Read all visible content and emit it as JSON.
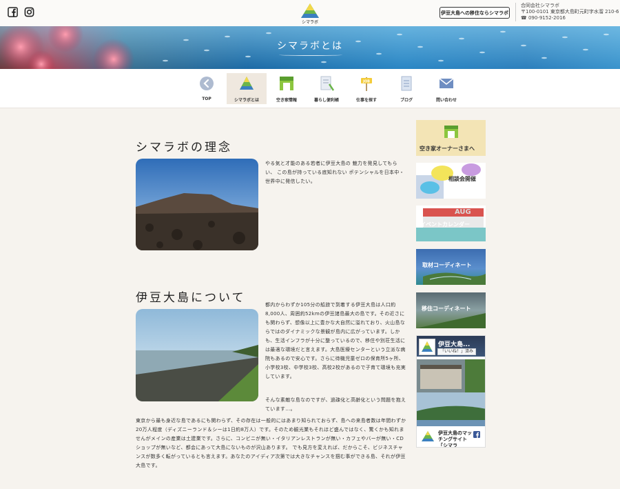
{
  "header": {
    "social": [
      "facebook-icon",
      "instagram-icon"
    ],
    "logo_text": "シマラボ",
    "cta_label": "伊豆大島への移住ならシマラボ",
    "company_name": "合同会社シマラボ",
    "company_address": "〒100-0101 東京都大島町元町字水溜 210-6",
    "company_phone": "☎ 090-9152-2016"
  },
  "hero": {
    "title": "シマラボとは"
  },
  "nav": {
    "items": [
      {
        "label": "TOP",
        "icon": "back-arrow-icon"
      },
      {
        "label": "シマラボとは",
        "icon": "mountain-logo-icon"
      },
      {
        "label": "空き家情報",
        "icon": "house-icon"
      },
      {
        "label": "暮らし便利帳",
        "icon": "notebook-icon"
      },
      {
        "label": "仕事を探す",
        "icon": "job-sign-icon"
      },
      {
        "label": "ブログ",
        "icon": "document-icon"
      },
      {
        "label": "問い合わせ",
        "icon": "mail-icon"
      }
    ],
    "active": "シマラボとは"
  },
  "main": {
    "section1": {
      "title": "シマラボの理念",
      "text": "やる気と才能のある若者に伊豆大島の 魅力を発見してもらい、 この島が持っている底知れない ポテンシャルを日本中・世界中に発信したい。"
    },
    "section2": {
      "title": "伊豆大島について",
      "text": "都内からわずか105分の船旅で到着する伊豆大島は人口約8,000人、周囲約52kmの伊豆諸島最大の島です。その近さにも関わらず、想像以上に豊かな大自然に溢れており、火山島ならではのダイナミックな景観が島内に広がっています。しかも、生活インフラが十分に整っているので、移住や別荘生活には最適な環境だと言えます。大島医療センターという立派な病院もあるので安心です。さらに待機児童ゼロの保育所5ヶ所、小学校3校、中学校3校、高校2校があるので子育て環境も充実しています。",
      "text2": "そんな素敵な島なのですが、過疎化と高齢化という問題を抱えています…。",
      "text3": "東京から最も身近な島であるにも関わらず、その存在は一般的にはあまり知られておらず、島への来島者数は年間わずか20万人程度（ディズニーランド＆シーは1日約8万人）です。そのため観光業もそれほど盛んではなく、驚くかも知れませんがメインの産業は土建業です。さらに、コンビニが無い・イタリアンレストランが無い・カフェやバーが無い・CDショップが無いなど、都会にあって大島にないものが沢山あります。 でも見方を変えれば、だからこそ、ビジネスチャンスが数多く転がっているとも言えます。あなたのアイディア次第では大きなチャンスを掴む事ができる島、それが伊豆大島です。"
    }
  },
  "sidebar": {
    "banners": [
      {
        "label": "空き家オーナーさまへ"
      },
      {
        "label": "相談会開催"
      },
      {
        "label": "イベントカレンダー",
        "sub": "AUG"
      },
      {
        "label": "取材コーディネート"
      },
      {
        "label": "移住コーディネート"
      }
    ],
    "fb": {
      "page_name": "伊豆大島...",
      "like_text": "「いいね！」済み",
      "post_title": "伊豆大島のマッチングサイト「シマラ",
      "logo_text": "シマラボ"
    }
  },
  "colors": {
    "accent_green": "#6cb54a",
    "nav_active_bg": "#efe8df",
    "page_bg": "#f6f3ee"
  }
}
